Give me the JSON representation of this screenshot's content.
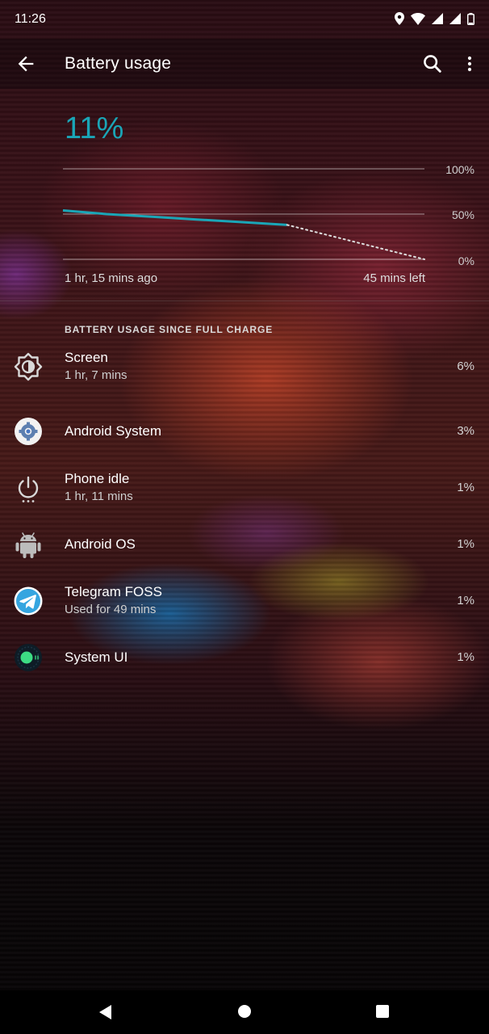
{
  "status_bar": {
    "time": "11:26"
  },
  "app_bar": {
    "title": "Battery usage"
  },
  "summary": {
    "percent": "11%",
    "y_labels": [
      "100%",
      "50%",
      "0%"
    ],
    "x_start": "1 hr, 15 mins ago",
    "x_end": "45 mins left"
  },
  "chart_data": {
    "type": "line",
    "ylim": [
      0,
      100
    ],
    "series": [
      {
        "style": "actual",
        "color": "#1aa6b7",
        "x": [
          0,
          0.12,
          0.25,
          0.37,
          0.5,
          0.62
        ],
        "values": [
          54,
          50,
          47,
          44,
          41,
          38
        ]
      },
      {
        "style": "projected",
        "color": "#dddddd",
        "x": [
          0.62,
          0.75,
          0.88,
          1.0
        ],
        "values": [
          38,
          25,
          12,
          0
        ]
      }
    ],
    "grid": true
  },
  "section": {
    "header": "BATTERY USAGE SINCE FULL CHARGE"
  },
  "items": [
    {
      "name": "Screen",
      "sub": "1 hr, 7 mins",
      "percent": "6%",
      "icon": "brightness-icon"
    },
    {
      "name": "Android System",
      "sub": "",
      "percent": "3%",
      "icon": "gear-icon"
    },
    {
      "name": "Phone idle",
      "sub": "1 hr, 11 mins",
      "percent": "1%",
      "icon": "power-icon"
    },
    {
      "name": "Android OS",
      "sub": "",
      "percent": "1%",
      "icon": "android-icon"
    },
    {
      "name": "Telegram FOSS",
      "sub": "Used for 49 mins",
      "percent": "1%",
      "icon": "telegram-icon"
    },
    {
      "name": "System UI",
      "sub": "",
      "percent": "1%",
      "icon": "android11-icon"
    }
  ],
  "colors": {
    "accent": "#1aa6b7"
  }
}
